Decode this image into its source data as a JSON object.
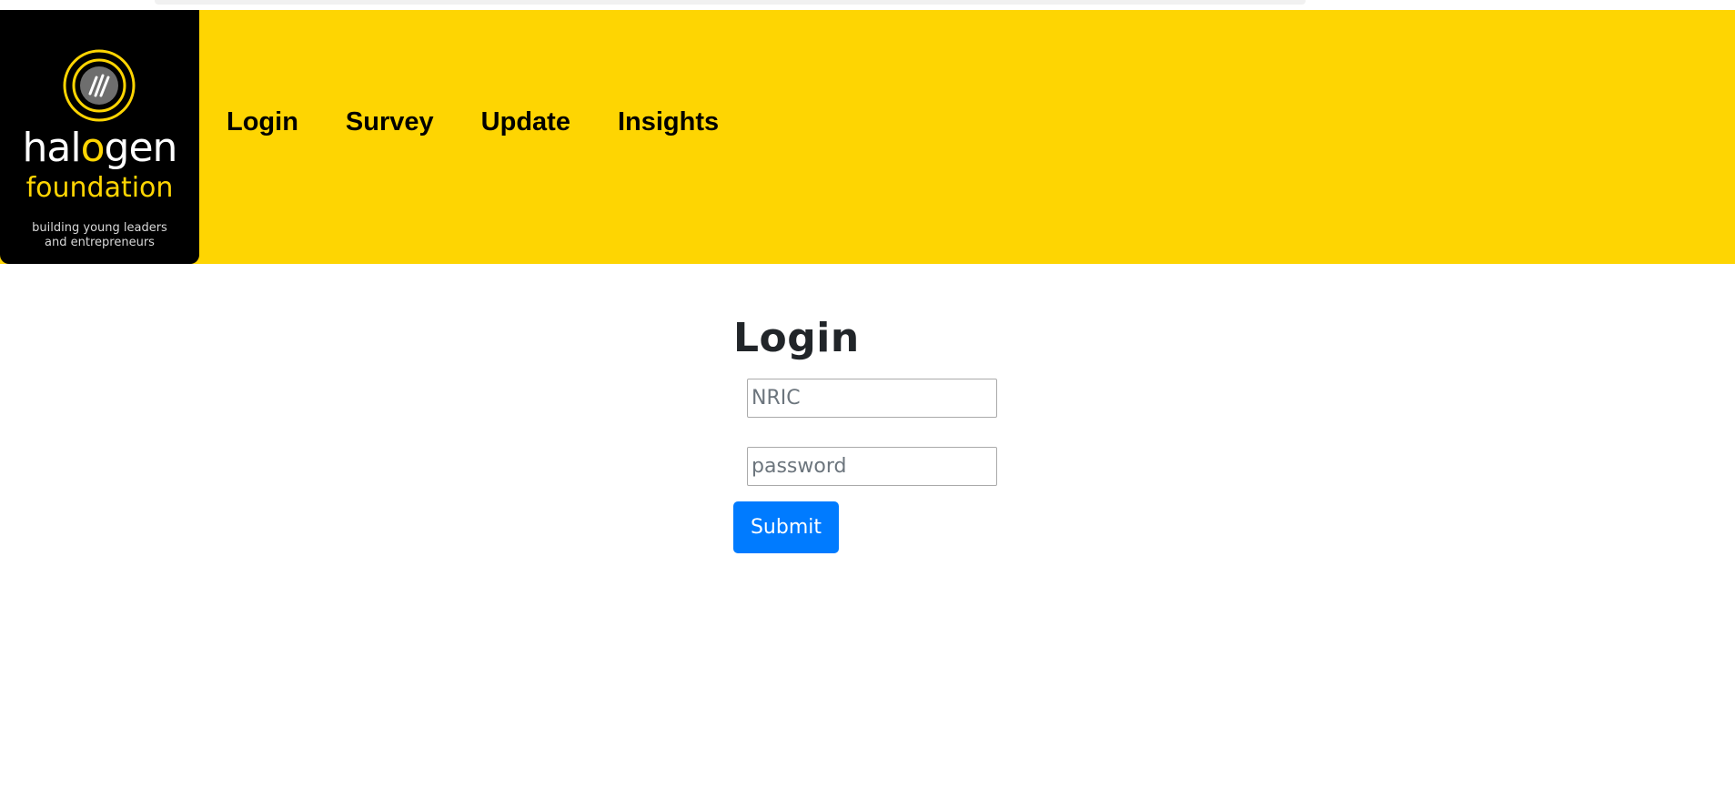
{
  "logo": {
    "name_part1": "hal",
    "name_accent": "o",
    "name_part2": "gen",
    "subname": "foundation",
    "tagline_line1": "building young leaders",
    "tagline_line2": "and entrepreneurs",
    "icon": "halogen-emblem-icon"
  },
  "nav": {
    "items": [
      {
        "label": "Login"
      },
      {
        "label": "Survey"
      },
      {
        "label": "Update"
      },
      {
        "label": "Insights"
      }
    ]
  },
  "login": {
    "title": "Login",
    "nric_placeholder": "NRIC",
    "password_placeholder": "password",
    "submit_label": "Submit"
  },
  "colors": {
    "header_bg": "#fed502",
    "logo_bg": "#000000",
    "button_bg": "#007bff"
  }
}
